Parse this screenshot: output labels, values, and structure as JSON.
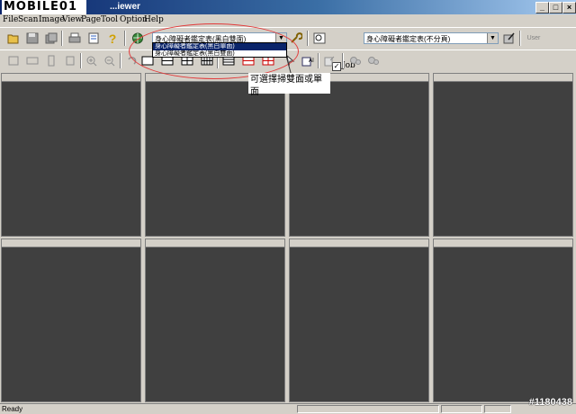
{
  "titlebar": {
    "logo": "MOBILE01",
    "title": "...iewer",
    "min": "_",
    "max": "□",
    "close": "×"
  },
  "menu": [
    "File",
    "Scan",
    "Image",
    "View",
    "Page",
    "Tool",
    "Option",
    "Help"
  ],
  "toolbar": {
    "profile_combo": "身心障礙者鑑定表(黑白雙面)",
    "profile_options": [
      "身心障礙者鑑定表(黑白單面)",
      "身心障礙者鑑定表(黑白雙面)"
    ],
    "job_label": "Job",
    "job_checked": "✓",
    "job_combo": "身心障礙者鑑定表(不分頁)",
    "user_label": "User"
  },
  "annotation": {
    "callout": "可選擇掃雙面或單面"
  },
  "status": {
    "text": "Ready",
    "watermark": "#1180438"
  },
  "colors": {
    "titlebar": "#0a246a",
    "thumbnail": "#404040",
    "annotation": "#e23a3a"
  }
}
